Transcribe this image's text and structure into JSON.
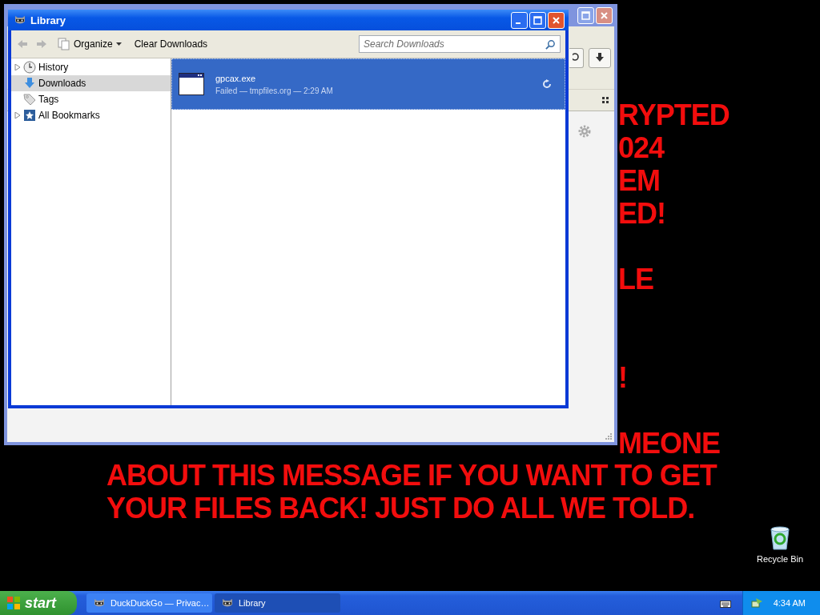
{
  "desktop": {
    "message_fragments": [
      "RYPTED",
      "024",
      "EM",
      "ED!",
      "LE",
      "!",
      "MEONE"
    ],
    "message_lines": [
      "ABOUT THIS MESSAGE IF YOU WANT TO GET",
      "YOUR FILES BACK! JUST DO ALL WE TOLD."
    ],
    "icons": [
      {
        "label": "Recycle Bin"
      }
    ]
  },
  "library": {
    "title": "Library",
    "toolbar": {
      "organize": "Organize",
      "clear": "Clear Downloads",
      "search": {
        "placeholder": "Search Downloads"
      }
    },
    "sidebar": [
      {
        "label": "History",
        "expandable": true,
        "selected": false,
        "kind": "history"
      },
      {
        "label": "Downloads",
        "expandable": false,
        "selected": true,
        "kind": "downloads"
      },
      {
        "label": "Tags",
        "expandable": false,
        "selected": false,
        "kind": "tags"
      },
      {
        "label": "All Bookmarks",
        "expandable": true,
        "selected": false,
        "kind": "bookmarks"
      }
    ],
    "downloads": [
      {
        "name": "gpcax.exe",
        "status": "Failed — tmpfiles.org — 2:29 AM",
        "selected": true
      }
    ]
  },
  "taskbar": {
    "start": "start",
    "tasks": [
      {
        "label": "DuckDuckGo — Privac…",
        "selected": false
      },
      {
        "label": "Library",
        "selected": true
      }
    ],
    "clock": "4:34 AM"
  }
}
